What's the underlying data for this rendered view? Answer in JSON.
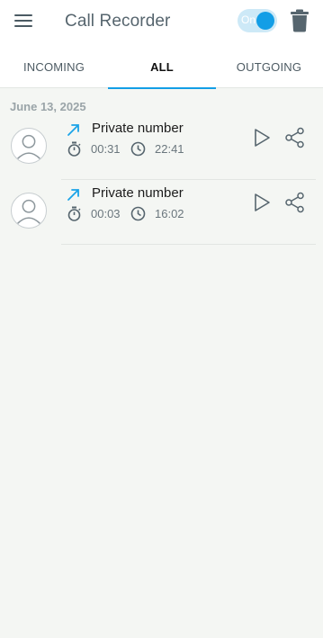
{
  "app": {
    "title": "Call Recorder"
  },
  "toggle": {
    "label": "On",
    "state": "on",
    "accent": "#139ee6"
  },
  "tabs": [
    {
      "label": "INCOMING",
      "active": false
    },
    {
      "label": "ALL",
      "active": true
    },
    {
      "label": "OUTGOING",
      "active": false
    }
  ],
  "date_group": "June 13, 2025",
  "calls": [
    {
      "name": "Private number",
      "direction": "outgoing-arrow-icon",
      "duration": "00:31",
      "time": "22:41"
    },
    {
      "name": "Private number",
      "direction": "outgoing-arrow-icon",
      "duration": "00:03",
      "time": "16:02"
    }
  ],
  "icons": [
    "menu-icon",
    "trash-icon",
    "avatar-icon",
    "timer-icon",
    "clock-icon",
    "play-icon",
    "share-icon"
  ]
}
